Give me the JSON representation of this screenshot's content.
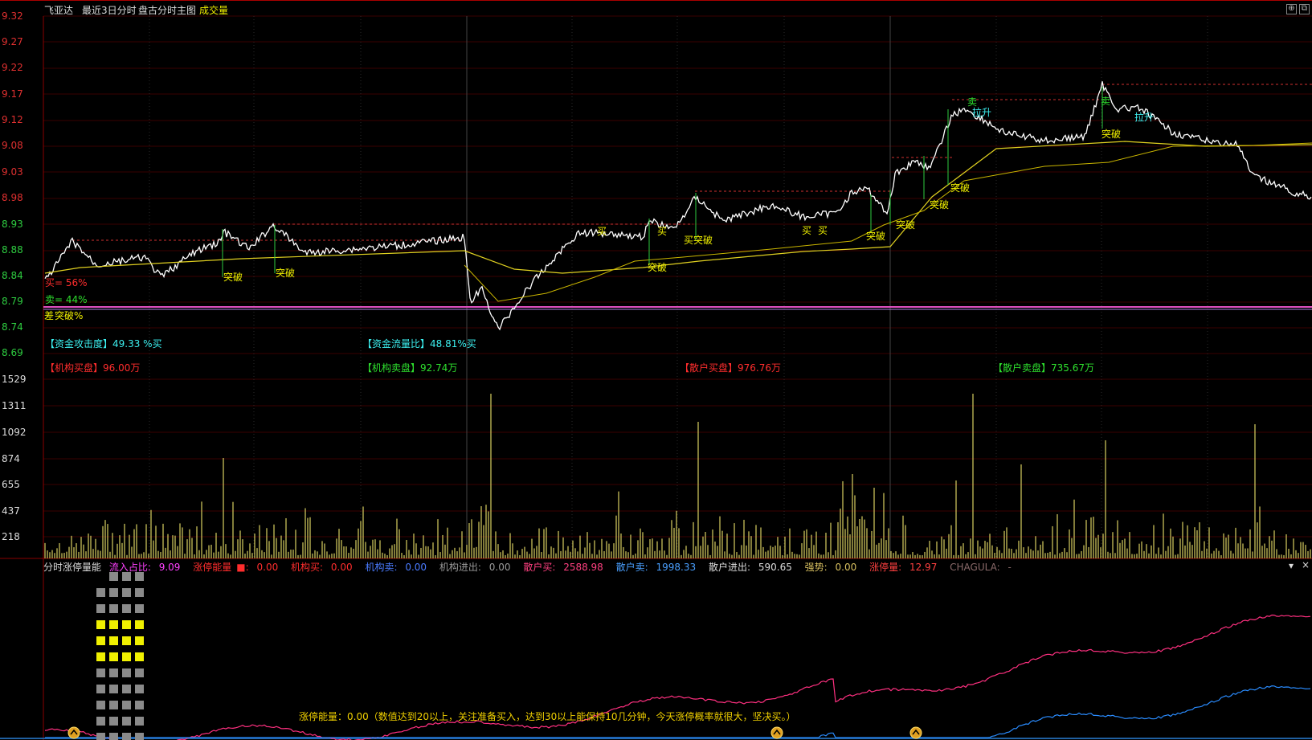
{
  "topbar": {
    "stock_name": "飞亚达",
    "title": "最近3日分时",
    "chart_name": "盘古分时主图",
    "volume_label": "成交量",
    "icon_plus": "⊕",
    "icon_restore": "⧉"
  },
  "price_axis": [
    "9.32",
    "9.27",
    "9.22",
    "9.17",
    "9.12",
    "9.08",
    "9.03",
    "8.98",
    "8.93",
    "8.88",
    "8.84",
    "8.79",
    "8.74",
    "8.69"
  ],
  "volume_axis": [
    "1529",
    "1311",
    "1092",
    "874",
    "655",
    "437",
    "218"
  ],
  "price_panel": {
    "left_labels": {
      "buy_pct": "买= 56%",
      "sell_pct": "卖= 44%",
      "diff": "差",
      "breakout_pct": "突破%"
    },
    "annotations": [
      {
        "text": "突破",
        "type": "breakout"
      },
      {
        "text": "突破",
        "type": "breakout"
      },
      {
        "text": "买",
        "type": "buy"
      },
      {
        "text": "买",
        "type": "buy"
      },
      {
        "text": "突破",
        "type": "breakout"
      },
      {
        "text": "买突破",
        "type": "buy-breakout"
      },
      {
        "text": "买",
        "type": "buy"
      },
      {
        "text": "买",
        "type": "buy"
      },
      {
        "text": "突破",
        "type": "breakout"
      },
      {
        "text": "突破",
        "type": "breakout"
      },
      {
        "text": "突破",
        "type": "breakout"
      },
      {
        "text": "突破",
        "type": "breakout"
      },
      {
        "text": "卖",
        "type": "sell"
      },
      {
        "text": "拉升",
        "type": "rally"
      },
      {
        "text": "卖",
        "type": "sell"
      },
      {
        "text": "突破",
        "type": "breakout"
      },
      {
        "text": "拉升",
        "type": "rally"
      }
    ]
  },
  "stats": {
    "attack": {
      "label": "【资金攻击度】",
      "value": "49.33 %买"
    },
    "flow_ratio": {
      "label": "【资金流量比】",
      "value": "48.81%买"
    },
    "inst_buy": {
      "label": "【机构买盘】",
      "value": "96.00万"
    },
    "inst_sell": {
      "label": "【机构卖盘】",
      "value": "92.74万"
    },
    "retail_buy": {
      "label": "【散户买盘】",
      "value": "976.76万"
    },
    "retail_sell": {
      "label": "【散户卖盘】",
      "value": "735.67万"
    }
  },
  "indicator_bar": {
    "name": "分时涨停量能",
    "items": [
      {
        "label": "流入占比:",
        "value": "9.09",
        "color": "#ff40ff"
      },
      {
        "label": "涨停能量",
        "value": "0.00",
        "color": "#ff2d2d",
        "marker": "■:"
      },
      {
        "label": "机构买:",
        "value": "0.00",
        "color": "#ff2d2d"
      },
      {
        "label": "机构卖:",
        "value": "0.00",
        "color": "#4a7bff"
      },
      {
        "label": "机构进出:",
        "value": "0.00",
        "color": "#9a9a9a"
      },
      {
        "label": "散户买:",
        "value": "2588.98",
        "color": "#ff4080"
      },
      {
        "label": "散户卖:",
        "value": "1998.33",
        "color": "#4aa0ff"
      },
      {
        "label": "散户进出:",
        "value": "590.65",
        "color": "#dddddd"
      },
      {
        "label": "强势:",
        "value": "0.00",
        "color": "#d8c060"
      },
      {
        "label": "涨停量:",
        "value": "12.97",
        "color": "#ff4040"
      },
      {
        "label": "CHAGULA:",
        "value": "-",
        "color": "#8a6a6a"
      }
    ],
    "icon_dropdown": "▾",
    "icon_close": "×"
  },
  "hint": "涨停能量：0.00（数值达到20以上，关注准备买入，达到30以上能保持10几分钟，今天涨停概率就很大，坚决买。）",
  "colors": {
    "price_line": "#ffffff",
    "avg_line": "#e0d020",
    "slow_line": "#c8b400",
    "vol_bar": "#d8d060",
    "retail_buy_line": "#ff3080",
    "retail_sell_line": "#2a8cff",
    "ref_line": "#e050c0"
  }
}
